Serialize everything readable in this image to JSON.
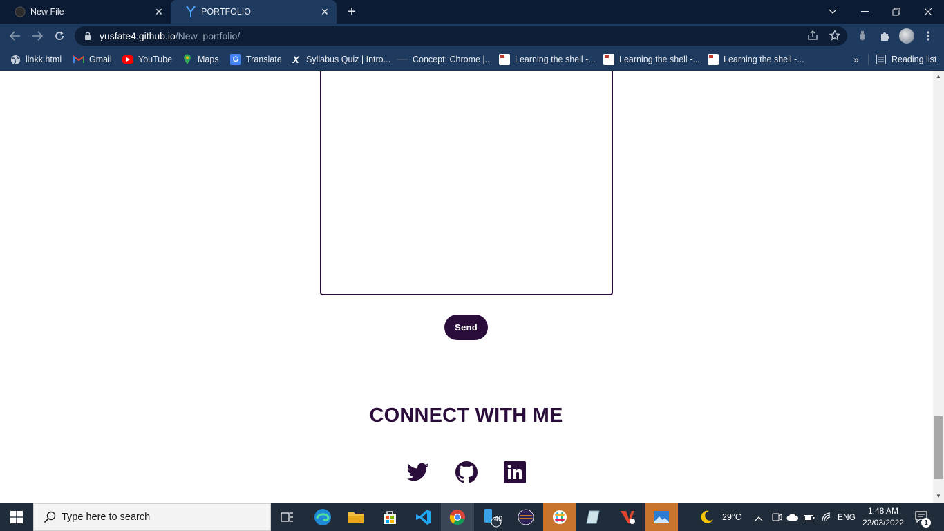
{
  "browser": {
    "tabs": [
      {
        "label": "New File",
        "active": false
      },
      {
        "label": "PORTFOLIO",
        "active": true
      }
    ],
    "new_tab": "+",
    "url_host": "yusfate4.github.io",
    "url_path": "/New_portfolio/",
    "bookmarks": [
      {
        "label": "linkk.html",
        "icon": "globe-icon"
      },
      {
        "label": "Gmail",
        "icon": "gmail-icon"
      },
      {
        "label": "YouTube",
        "icon": "youtube-icon"
      },
      {
        "label": "Maps",
        "icon": "maps-icon"
      },
      {
        "label": "Translate",
        "icon": "translate-icon"
      },
      {
        "label": "Syllabus Quiz | Intro...",
        "icon": "x-icon"
      },
      {
        "label": "Concept: Chrome |...",
        "icon": "concept-icon"
      },
      {
        "label": "Learning the shell -...",
        "icon": "doc-icon"
      },
      {
        "label": "Learning the shell -...",
        "icon": "doc-icon"
      },
      {
        "label": "Learning the shell -...",
        "icon": "doc-icon"
      }
    ],
    "bookmarks_overflow": "»",
    "reading_list": "Reading list"
  },
  "page": {
    "send_label": "Send",
    "connect_title": "CONNECT WITH ME",
    "social": [
      "twitter-icon",
      "github-icon",
      "linkedin-icon"
    ],
    "accent_color": "#2a0d3a"
  },
  "taskbar": {
    "search_placeholder": "Type here to search",
    "badge_count": "40",
    "weather": "29°C",
    "language": "ENG",
    "time": "1:48 AM",
    "date": "22/03/2022",
    "notification_count": "1"
  }
}
